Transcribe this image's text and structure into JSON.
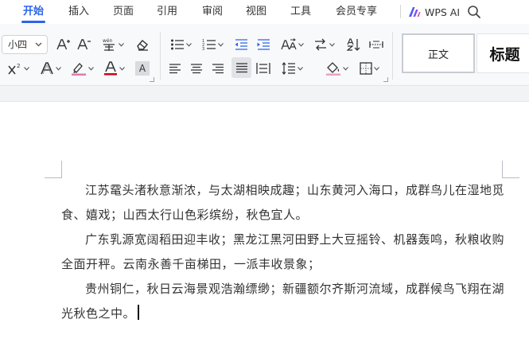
{
  "tabs": [
    {
      "label": "开始",
      "active": true
    },
    {
      "label": "插入",
      "active": false
    },
    {
      "label": "页面",
      "active": false
    },
    {
      "label": "引用",
      "active": false
    },
    {
      "label": "审阅",
      "active": false
    },
    {
      "label": "视图",
      "active": false
    },
    {
      "label": "工具",
      "active": false
    },
    {
      "label": "会员专享",
      "active": false
    }
  ],
  "wps_ai": {
    "label": "WPS AI"
  },
  "ribbon": {
    "font_size": "小四",
    "clear_format_glyph": "A",
    "styles": {
      "normal": "正文",
      "heading": "标题"
    }
  },
  "colors": {
    "accent": "#2b64e8",
    "highlight_color": "#e27ab0",
    "font_color_bar": "#d0021b",
    "shading_fill": "#e8a0c8"
  },
  "document": {
    "paragraphs": [
      "江苏鼋头渚秋意渐浓，与太湖相映成趣；山东黄河入海口，成群鸟儿在湿地觅食、嬉戏；山西太行山色彩缤纷，秋色宜人。",
      "广东乳源宽阔稻田迎丰收；黑龙江黑河田野上大豆摇铃、机器轰鸣，秋粮收购全面开秤。云南永善千亩梯田，一派丰收景象；",
      "贵州铜仁，秋日云海景观浩瀚缥缈；新疆额尔齐斯河流域，成群候鸟飞翔在湖光秋色之中。"
    ]
  }
}
